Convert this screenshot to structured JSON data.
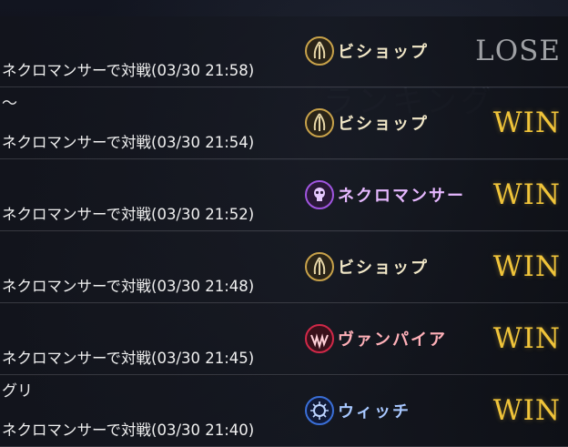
{
  "battles": [
    {
      "title": "",
      "info": "ネクロマンサーで対戦(03/30 21:58)",
      "opponent_class": "ビショップ",
      "class_icon": "bishop-icon",
      "class_color": "#f2e8c8",
      "emblem_color": "#c8a24a",
      "result": "LOSE",
      "result_kind": "lose"
    },
    {
      "title": "〜",
      "info": "ネクロマンサーで対戦(03/30 21:54)",
      "opponent_class": "ビショップ",
      "class_icon": "bishop-icon",
      "class_color": "#f2e8c8",
      "emblem_color": "#c8a24a",
      "result": "WIN",
      "result_kind": "win"
    },
    {
      "title": "",
      "info": "ネクロマンサーで対戦(03/30 21:52)",
      "opponent_class": "ネクロマンサー",
      "class_icon": "necromancer-icon",
      "class_color": "#e6b8ff",
      "emblem_color": "#a055e0",
      "result": "WIN",
      "result_kind": "win"
    },
    {
      "title": "",
      "info": "ネクロマンサーで対戦(03/30 21:48)",
      "opponent_class": "ビショップ",
      "class_icon": "bishop-icon",
      "class_color": "#f2e8c8",
      "emblem_color": "#c8a24a",
      "result": "WIN",
      "result_kind": "win"
    },
    {
      "title": "",
      "info": "ネクロマンサーで対戦(03/30 21:45)",
      "opponent_class": "ヴァンパイア",
      "class_icon": "vampire-icon",
      "class_color": "#ffb0b8",
      "emblem_color": "#d02848",
      "result": "WIN",
      "result_kind": "win"
    },
    {
      "title": "グリ",
      "info": "ネクロマンサーで対戦(03/30 21:40)",
      "opponent_class": "ウィッチ",
      "class_icon": "witch-icon",
      "class_color": "#a8c8ff",
      "emblem_color": "#3a6fd8",
      "result": "WIN",
      "result_kind": "win"
    }
  ]
}
